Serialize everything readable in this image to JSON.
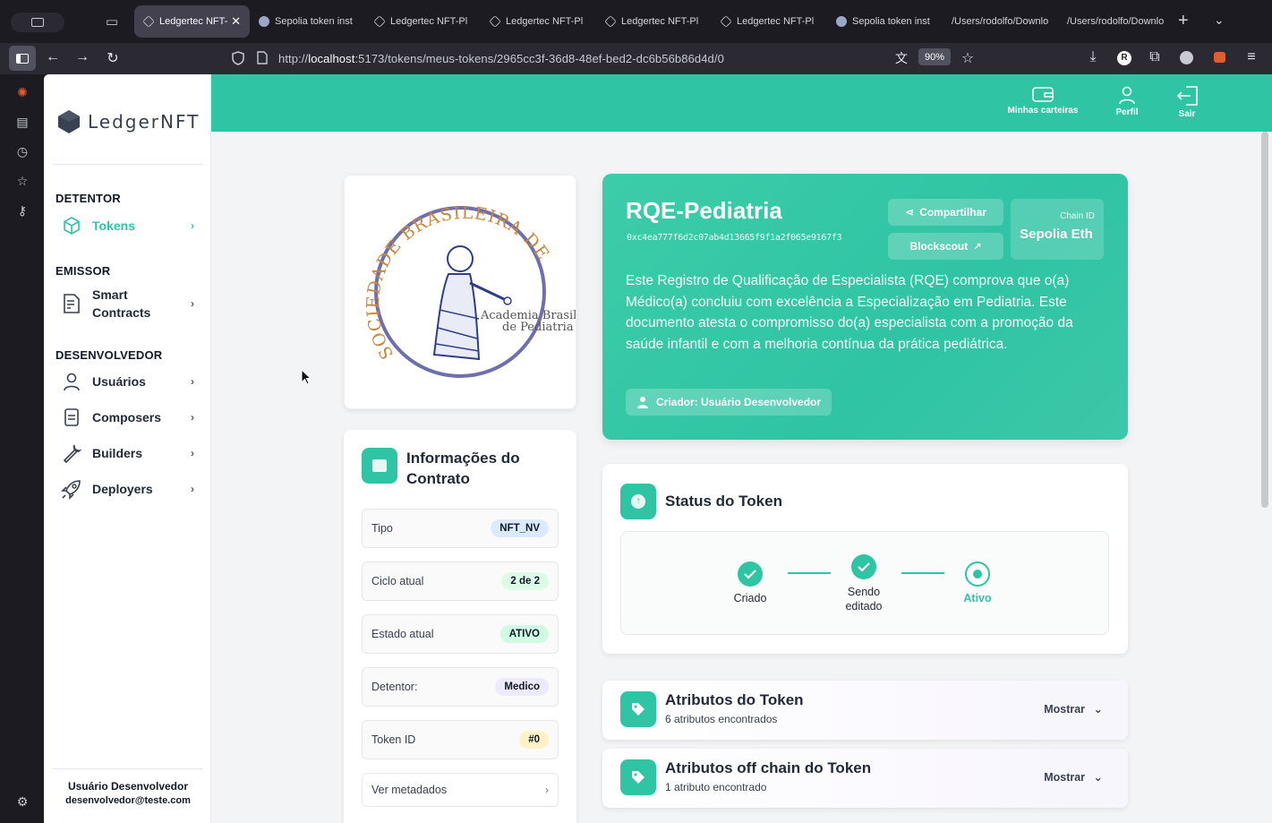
{
  "browser": {
    "tabs": [
      {
        "label": "Ledgertec NFT-",
        "active": true
      },
      {
        "label": "Sepolia token inst",
        "active": false
      },
      {
        "label": "Ledgertec NFT-Pl",
        "active": false
      },
      {
        "label": "Ledgertec NFT-Pl",
        "active": false
      },
      {
        "label": "Ledgertec NFT-Pl",
        "active": false
      },
      {
        "label": "Ledgertec NFT-Pl",
        "active": false
      },
      {
        "label": "Sepolia token inst",
        "active": false
      },
      {
        "label": "/Users/rodolfo/Downlo",
        "active": false
      },
      {
        "label": "/Users/rodolfo/Downlo",
        "active": false
      }
    ],
    "url_prefix": "http://",
    "url_host": "localhost",
    "url_rest": ":5173/tokens/meus-tokens/2965cc3f-36d8-48ef-bed2-dc6b56b86d4d/0",
    "zoom": "90%"
  },
  "sidebar": {
    "logo": "LedgerNFT",
    "sections": [
      {
        "title": "DETENTOR"
      },
      {
        "title": "EMISSOR"
      },
      {
        "title": "DESENVOLVEDOR"
      }
    ],
    "items": {
      "tokens": "Tokens",
      "smart_contracts_1": "Smart",
      "smart_contracts_2": "Contracts",
      "usuarios": "Usuários",
      "composers": "Composers",
      "builders": "Builders",
      "deployers": "Deployers"
    },
    "user_name": "Usuário Desenvolvedor",
    "user_email": "desenvolvedor@teste.com"
  },
  "topnav": {
    "wallets": "Minhas carteiras",
    "profile": "Perfil",
    "logout": "Sair"
  },
  "token": {
    "name": "RQE-Pediatria",
    "address": "0xc4ea777f6d2c07ab4d13665f9f1a2f065e9167f3",
    "share": "Compartilhar",
    "explorer": "Blockscout",
    "chain_label": "Chain ID",
    "chain_value": "Sepolia Eth",
    "description": "Este Registro de Qualificação de Especialista (RQE) comprova que o(a) Médico(a) concluiu com excelência a Especialização em Pediatria. Este documento atesta o compromisso do(a) especialista com a promoção da saúde infantil e com a melhoria contínua da prática pediátrica.",
    "creator": "Criador: Usuário Desenvolvedor",
    "image_text_arc": "SOCIEDADE BRASILEIRA DE PEDIATRIA",
    "image_text_1": "Academia Brasile",
    "image_text_2": "de Pediatria"
  },
  "contract_info": {
    "title": "Informações do Contrato",
    "rows": [
      {
        "label": "Tipo",
        "value": "NFT_NV"
      },
      {
        "label": "Ciclo atual",
        "value": "2 de 2"
      },
      {
        "label": "Estado atual",
        "value": "ATIVO"
      },
      {
        "label": "Detentor:",
        "value": "Medico"
      },
      {
        "label": "Token ID",
        "value": "#0"
      }
    ],
    "metadata_link": "Ver metadados"
  },
  "status": {
    "title": "Status do Token",
    "steps": [
      "Criado",
      "Sendo editado",
      "Ativo"
    ]
  },
  "attributes": {
    "title": "Atributos do Token",
    "subtitle": "6 atributos encontrados",
    "toggle": "Mostrar"
  },
  "offchain": {
    "title": "Atributos off chain do Token",
    "subtitle": "1 atributo encontrado",
    "toggle": "Mostrar"
  },
  "colors": {
    "accent": "#2fc4a4",
    "browser_bg": "#1c1b22"
  }
}
